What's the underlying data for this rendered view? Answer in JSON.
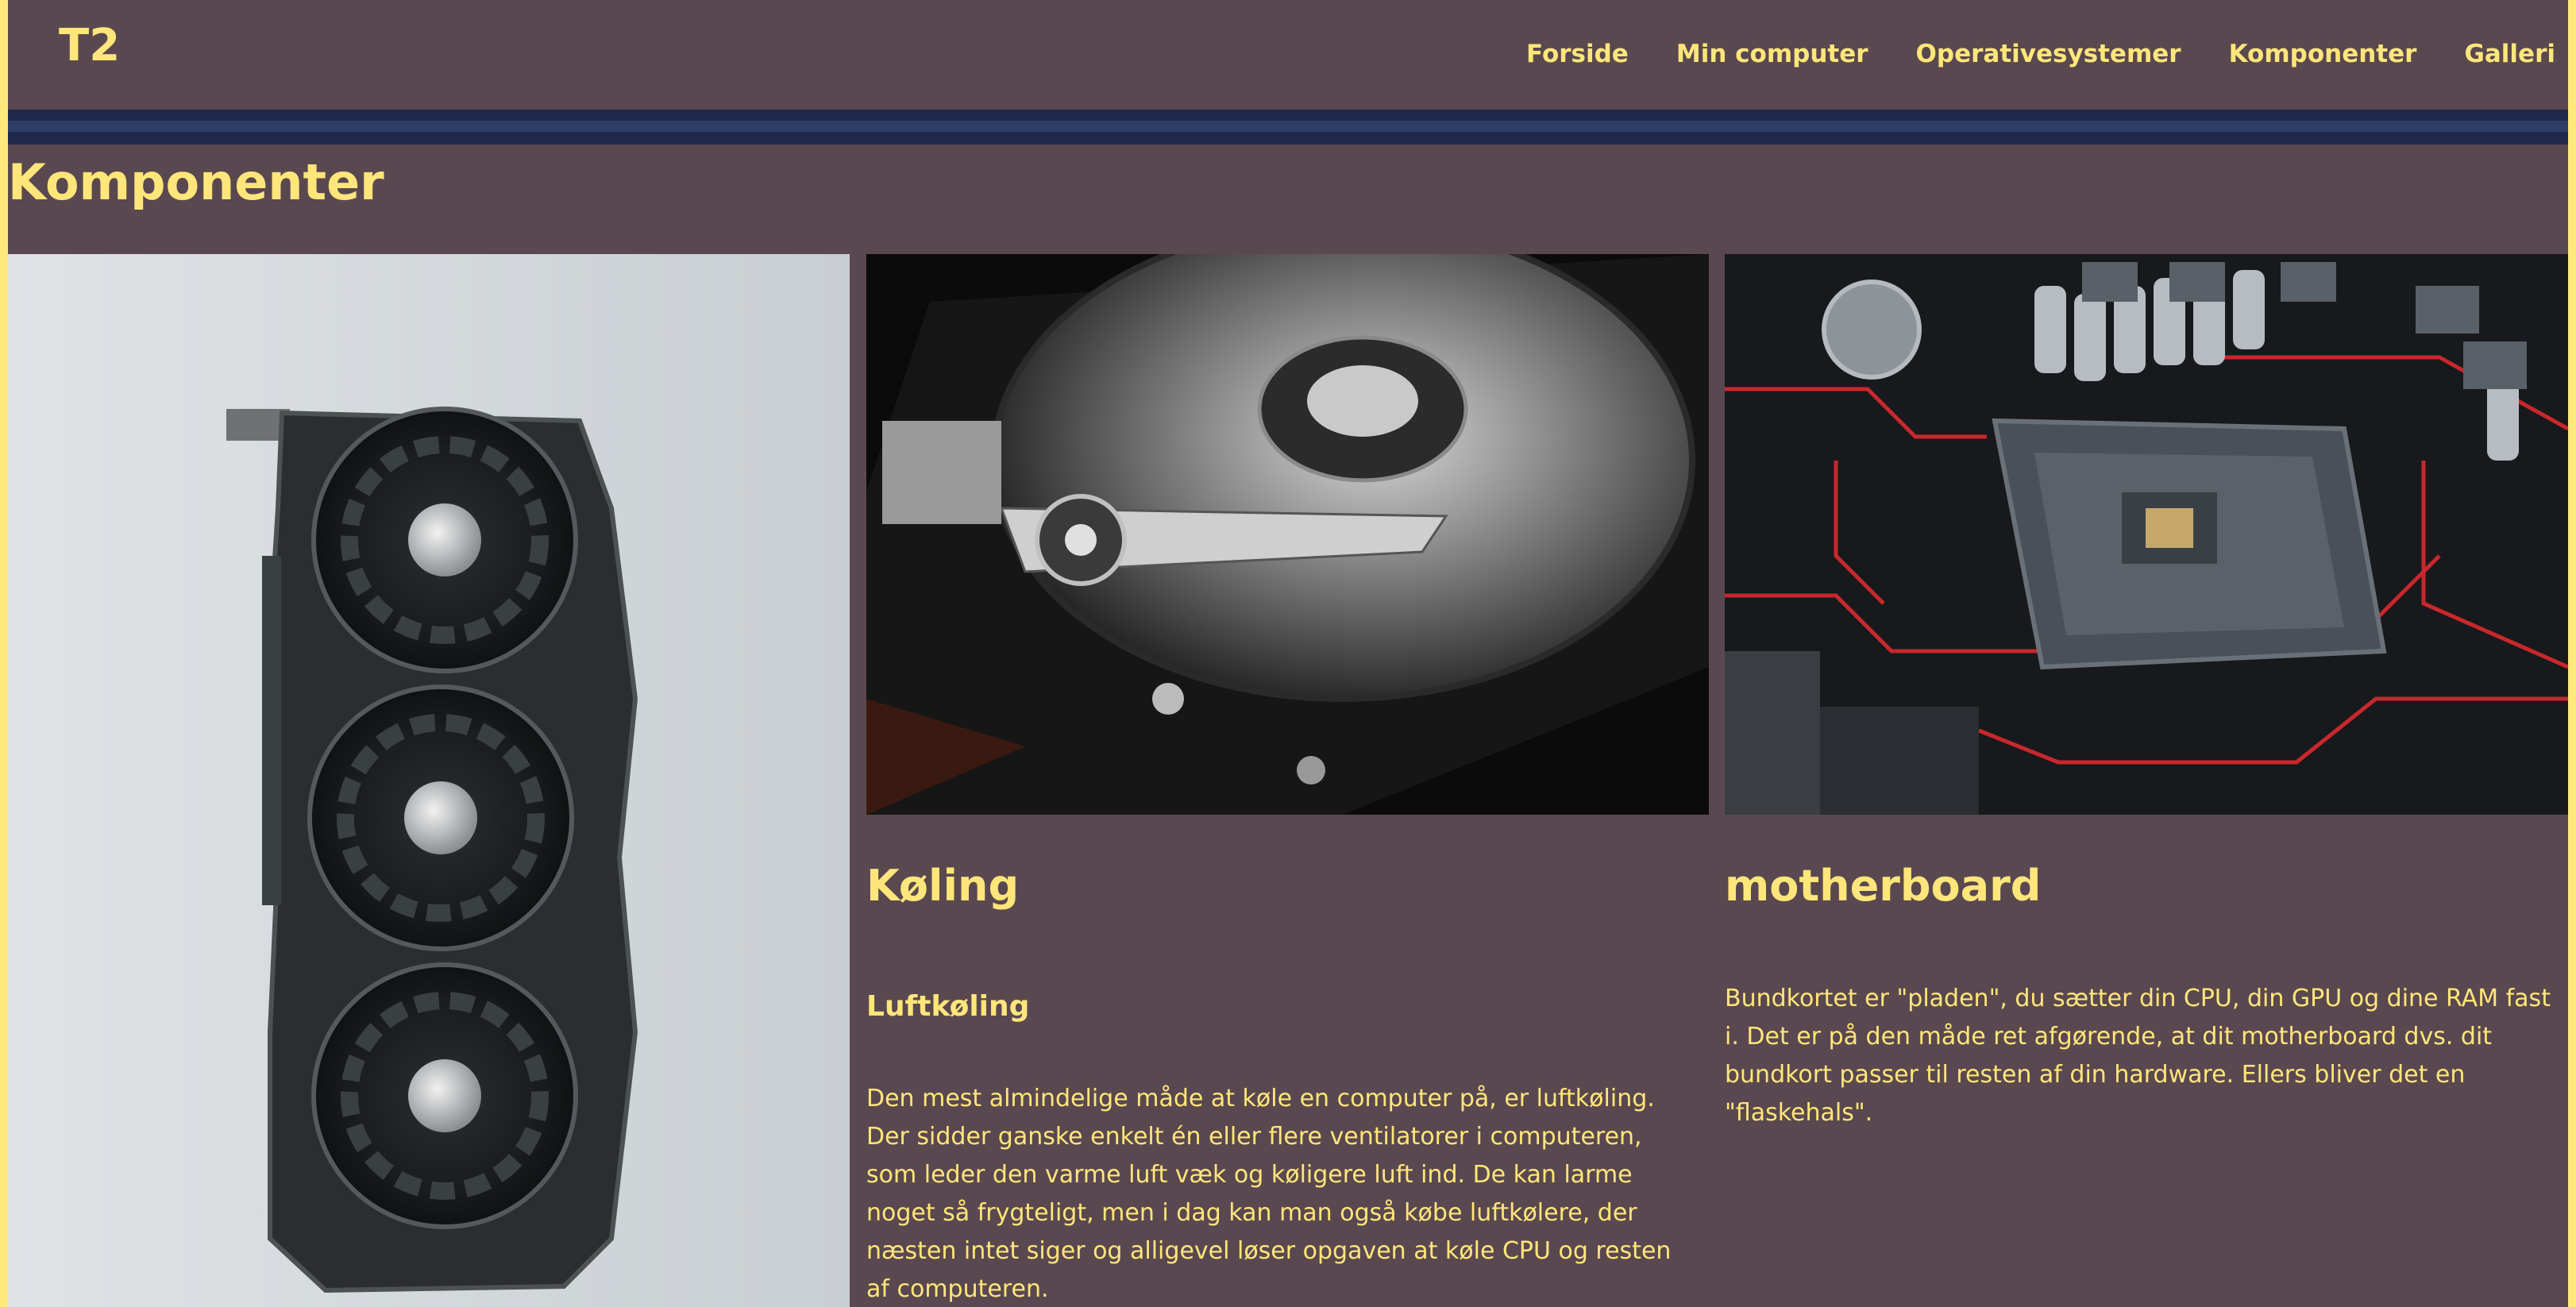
{
  "header": {
    "logo": "T2",
    "nav": [
      {
        "label": "Forside"
      },
      {
        "label": "Min computer"
      },
      {
        "label": "Operativesystemer"
      },
      {
        "label": "Komponenter"
      },
      {
        "label": "Galleri"
      }
    ]
  },
  "main": {
    "title": "Komponenter",
    "cooling": {
      "heading": "Køling",
      "subheading": "Luftkøling",
      "text": "Den mest almindelige måde at køle en computer på, er luftkøling. Der sidder ganske enkelt én eller flere ventilatorer i computeren, som leder den varme luft væk og køligere luft ind. De kan larme noget så frygteligt, men i dag kan man også købe luftkølere, der næsten intet siger og alligevel løser opgaven at køle CPU og resten af computeren."
    },
    "motherboard": {
      "heading": "motherboard",
      "text": "Bundkortet er \"pladen\", du sætter din CPU, din GPU og dine RAM fast i. Det er på den måde ret afgørende, at dit motherboard dvs. dit bundkort passer til resten af din hardware. Ellers bliver det en \"flaskehals\"."
    },
    "images": [
      {
        "name": "graphics-card-photo"
      },
      {
        "name": "hard-drive-photo"
      },
      {
        "name": "motherboard-photo"
      }
    ]
  },
  "colors": {
    "background": "#5a4850",
    "accent_text": "#ffe67a",
    "stripe": "#1f2a4a",
    "page_border": "#ffe97a"
  }
}
